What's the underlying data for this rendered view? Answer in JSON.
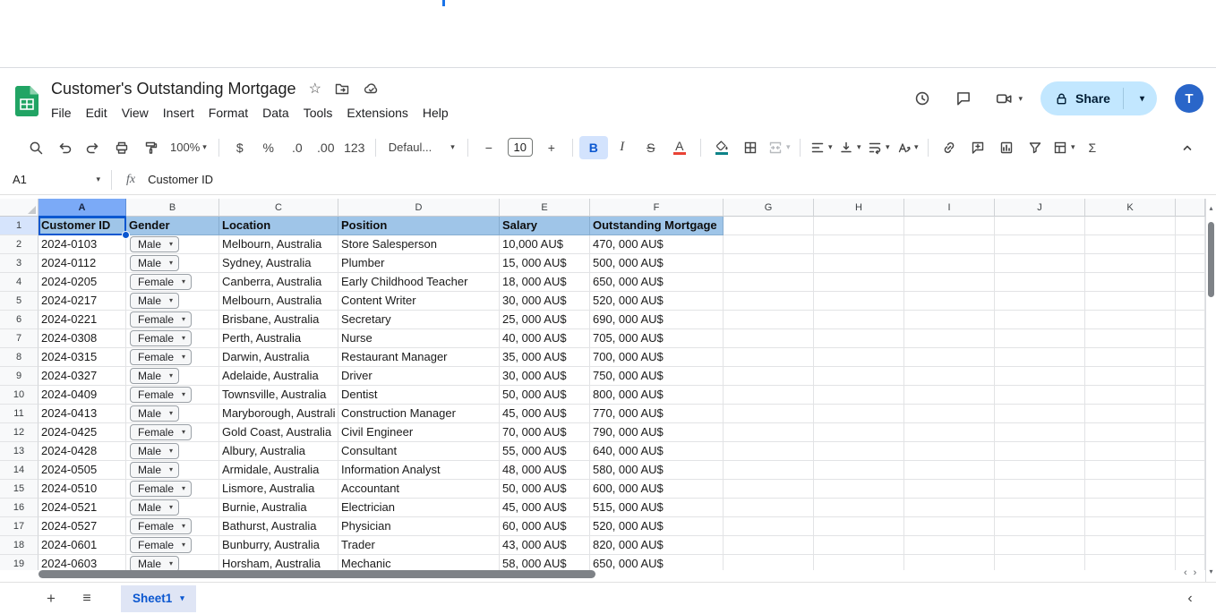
{
  "header": {
    "title": "Customer's Outstanding Mortgage",
    "menus": [
      "File",
      "Edit",
      "View",
      "Insert",
      "Format",
      "Data",
      "Tools",
      "Extensions",
      "Help"
    ],
    "share_label": "Share",
    "avatar_initial": "T"
  },
  "toolbar": {
    "zoom": "100%",
    "currency": "$",
    "percent": "%",
    "decrease_decimal": ".0",
    "increase_decimal": ".00",
    "more_formats": "123",
    "font_name": "Defaul...",
    "decrease_font": "−",
    "font_size": "10",
    "increase_font": "+",
    "bold": "B",
    "italic": "I",
    "strikethrough": "S",
    "text_color": "A",
    "functions": "Σ"
  },
  "formula_bar": {
    "name_box": "A1",
    "fx": "fx",
    "formula": "Customer ID"
  },
  "grid": {
    "columns": [
      "A",
      "B",
      "C",
      "D",
      "E",
      "F",
      "G",
      "H",
      "I",
      "J",
      "K"
    ],
    "selected_cell": "A1",
    "header_row": [
      "Customer ID",
      "Gender",
      "Location",
      "Position",
      "Salary",
      "Outstanding Mortgage"
    ],
    "rows": [
      {
        "id": "2024-0103",
        "gender": "Male",
        "location": "Melbourn, Australia",
        "position": "Store Salesperson",
        "salary": "10,000 AU$",
        "mortgage": "470, 000 AU$"
      },
      {
        "id": "2024-0112",
        "gender": "Male",
        "location": "Sydney, Australia",
        "position": "Plumber",
        "salary": "15, 000 AU$",
        "mortgage": "500, 000 AU$"
      },
      {
        "id": "2024-0205",
        "gender": "Female",
        "location": "Canberra, Australia",
        "position": "Early Childhood Teacher",
        "salary": "18, 000 AU$",
        "mortgage": "650, 000 AU$"
      },
      {
        "id": "2024-0217",
        "gender": "Male",
        "location": "Melbourn, Australia",
        "position": "Content Writer",
        "salary": "30, 000 AU$",
        "mortgage": "520, 000 AU$"
      },
      {
        "id": "2024-0221",
        "gender": "Female",
        "location": "Brisbane, Australia",
        "position": "Secretary",
        "salary": "25, 000 AU$",
        "mortgage": "690, 000 AU$"
      },
      {
        "id": "2024-0308",
        "gender": "Female",
        "location": "Perth, Australia",
        "position": "Nurse",
        "salary": "40, 000 AU$",
        "mortgage": "705, 000 AU$"
      },
      {
        "id": "2024-0315",
        "gender": "Female",
        "location": "Darwin, Australia",
        "position": "Restaurant Manager",
        "salary": "35, 000 AU$",
        "mortgage": "700, 000 AU$"
      },
      {
        "id": "2024-0327",
        "gender": "Male",
        "location": "Adelaide, Australia",
        "position": "Driver",
        "salary": "30, 000 AU$",
        "mortgage": "750, 000 AU$"
      },
      {
        "id": "2024-0409",
        "gender": "Female",
        "location": "Townsville, Australia",
        "position": "Dentist",
        "salary": "50, 000 AU$",
        "mortgage": "800, 000 AU$"
      },
      {
        "id": "2024-0413",
        "gender": "Male",
        "location": "Maryborough, Australi",
        "position": "Construction Manager",
        "salary": "45, 000 AU$",
        "mortgage": "770, 000 AU$"
      },
      {
        "id": "2024-0425",
        "gender": "Female",
        "location": "Gold Coast, Australia",
        "position": "Civil Engineer",
        "salary": "70, 000 AU$",
        "mortgage": "790, 000 AU$"
      },
      {
        "id": "2024-0428",
        "gender": "Male",
        "location": "Albury, Australia",
        "position": "Consultant",
        "salary": "55, 000 AU$",
        "mortgage": "640, 000 AU$"
      },
      {
        "id": "2024-0505",
        "gender": "Male",
        "location": "Armidale, Australia",
        "position": "Information Analyst",
        "salary": "48, 000 AU$",
        "mortgage": "580, 000 AU$"
      },
      {
        "id": "2024-0510",
        "gender": "Female",
        "location": "Lismore, Australia",
        "position": "Accountant",
        "salary": "50, 000 AU$",
        "mortgage": "600, 000 AU$"
      },
      {
        "id": "2024-0521",
        "gender": "Male",
        "location": "Burnie, Australia",
        "position": "Electrician",
        "salary": "45, 000 AU$",
        "mortgage": "515, 000 AU$"
      },
      {
        "id": "2024-0527",
        "gender": "Female",
        "location": "Bathurst, Australia",
        "position": "Physician",
        "salary": "60, 000 AU$",
        "mortgage": "520, 000 AU$"
      },
      {
        "id": "2024-0601",
        "gender": "Female",
        "location": "Bunburry, Australia",
        "position": "Trader",
        "salary": "43, 000 AU$",
        "mortgage": "820, 000 AU$"
      },
      {
        "id": "2024-0603",
        "gender": "Male",
        "location": "Horsham, Australia",
        "position": "Mechanic",
        "salary": "58, 000 AU$",
        "mortgage": "650, 000 AU$"
      }
    ]
  },
  "sheet_bar": {
    "active_tab": "Sheet1"
  },
  "icons": {
    "caret-down": "▾",
    "star": "☆",
    "plus": "+",
    "minus": "−",
    "hamburger": "≡",
    "chevron-left": "‹",
    "chevron-right": "›",
    "arrow-up-small": "▴",
    "arrow-down-small": "▾"
  },
  "colors": {
    "accent": "#1a73e8",
    "selection": "#0b57d0",
    "header_fill": "#9fc5e8",
    "selected_col_header": "#7baaf7",
    "share_bg": "#c2e7ff",
    "text_color_swatch": "#e94235",
    "fill_color_swatch": "#0e8388"
  }
}
